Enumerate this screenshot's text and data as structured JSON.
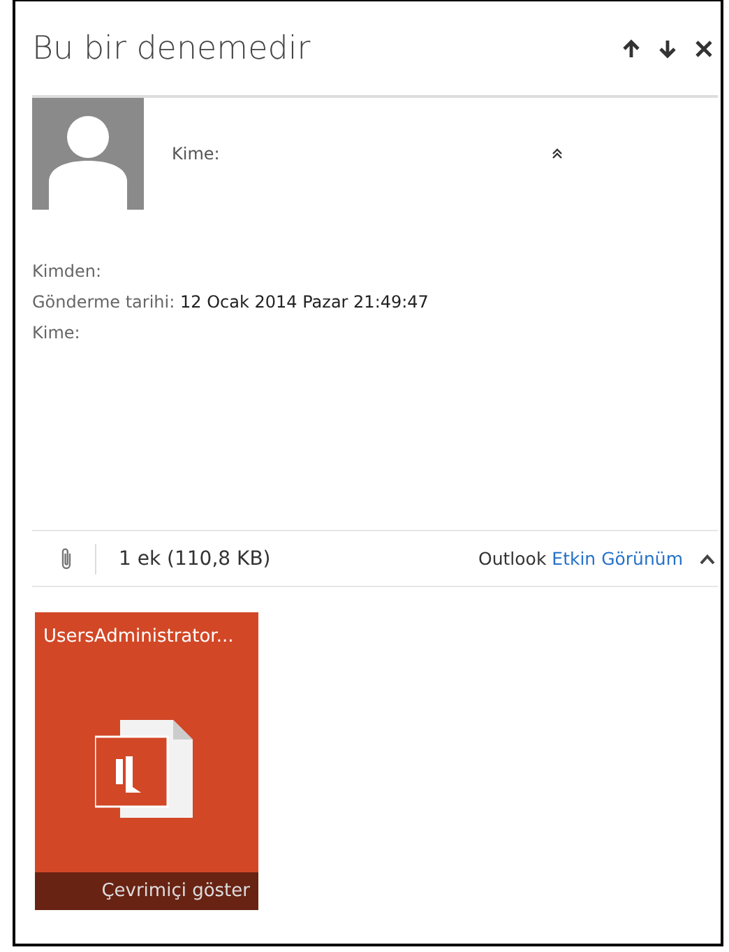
{
  "title": "Bu bir denemedir",
  "header_actions": [
    {
      "kind": "up"
    },
    {
      "kind": "down"
    },
    {
      "kind": "close"
    }
  ],
  "recipient_line": {
    "label": "Kime:"
  },
  "details": [
    {
      "label": "Kimden:"
    },
    {
      "label": "Gönderme tarihi:",
      "value": "12 Ocak 2014 Pazar 21:49:47"
    },
    {
      "label": "Kime:"
    }
  ],
  "attachment_bar": {
    "count": "1 ek (110,8 KB)",
    "view_prefix": "Outlook",
    "view_link": "Etkin Görünüm"
  },
  "attachments": [
    {
      "name": "UsersAdministrator...",
      "action": "Çevrimiçi göster",
      "color": "#d24726"
    }
  ]
}
